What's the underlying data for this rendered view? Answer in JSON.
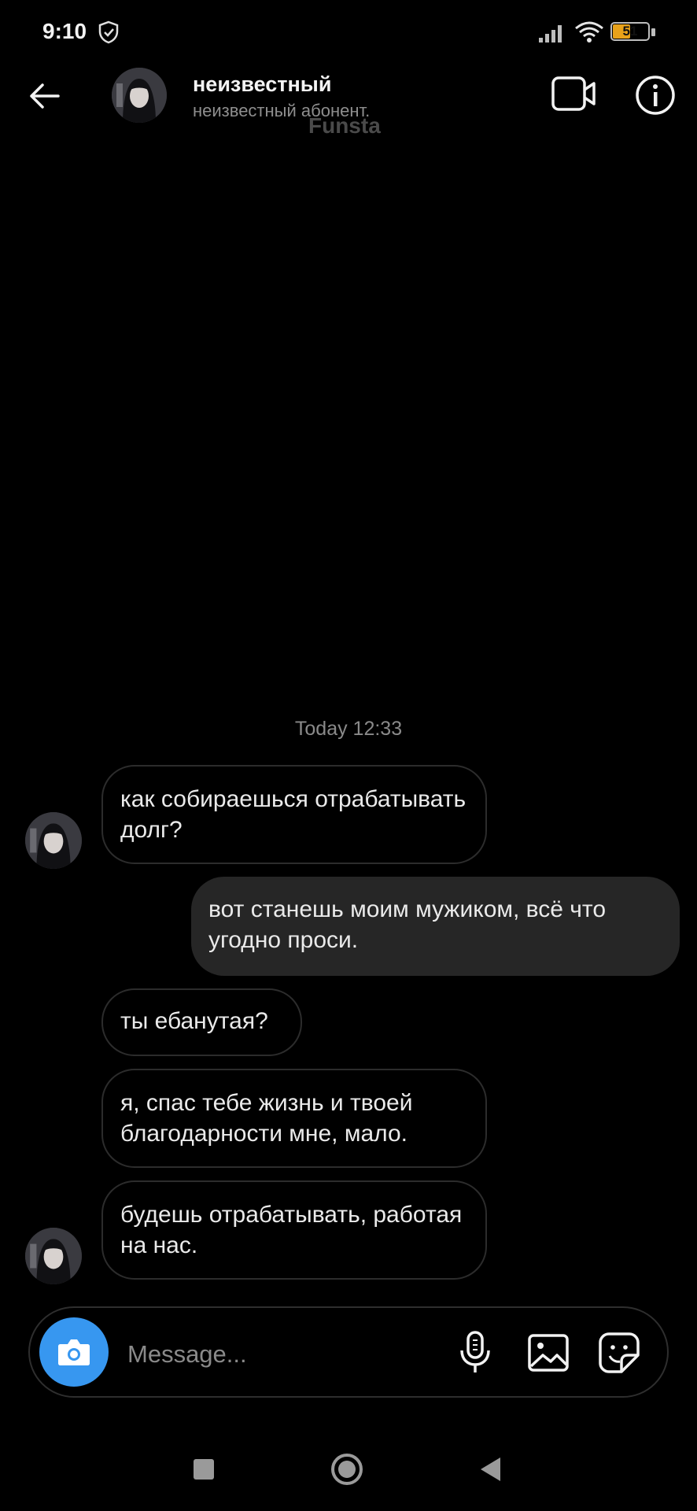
{
  "status_bar": {
    "time": "9:10",
    "battery": "51",
    "battery_level": 0.51,
    "icons": [
      "shield-icon",
      "signal-icon",
      "wifi-icon",
      "battery-icon"
    ]
  },
  "header": {
    "back_icon": "arrow-left-icon",
    "name": "неизвестный",
    "subtitle": "неизвестный абонент.",
    "watermark": "Funsta",
    "video_icon": "video-camera-icon",
    "info_icon": "info-icon"
  },
  "chat": {
    "timestamp": "Today 12:33",
    "messages": [
      {
        "direction": "incoming",
        "text": "как собираешься отрабатывать долг?"
      },
      {
        "direction": "outgoing",
        "text": "вот станешь моим мужиком, всё что угодно проси."
      },
      {
        "direction": "incoming",
        "text": "ты ебанутая?"
      },
      {
        "direction": "incoming",
        "text": "я, спас тебе жизнь и твоей благодарности мне, мало."
      },
      {
        "direction": "incoming",
        "text": "будешь отрабатывать, работая на нас."
      }
    ]
  },
  "composer": {
    "placeholder": "Message...",
    "icons": [
      "camera-icon",
      "microphone-icon",
      "gallery-icon",
      "sticker-icon"
    ]
  },
  "nav_bar": {
    "icons": [
      "recents-icon",
      "home-icon",
      "back-icon"
    ]
  },
  "colors": {
    "background": "#000000",
    "outgoing_bubble": "#262626",
    "incoming_border": "#2c2c2c",
    "camera_button": "#3797f0",
    "battery_fill": "#e8a21a"
  }
}
